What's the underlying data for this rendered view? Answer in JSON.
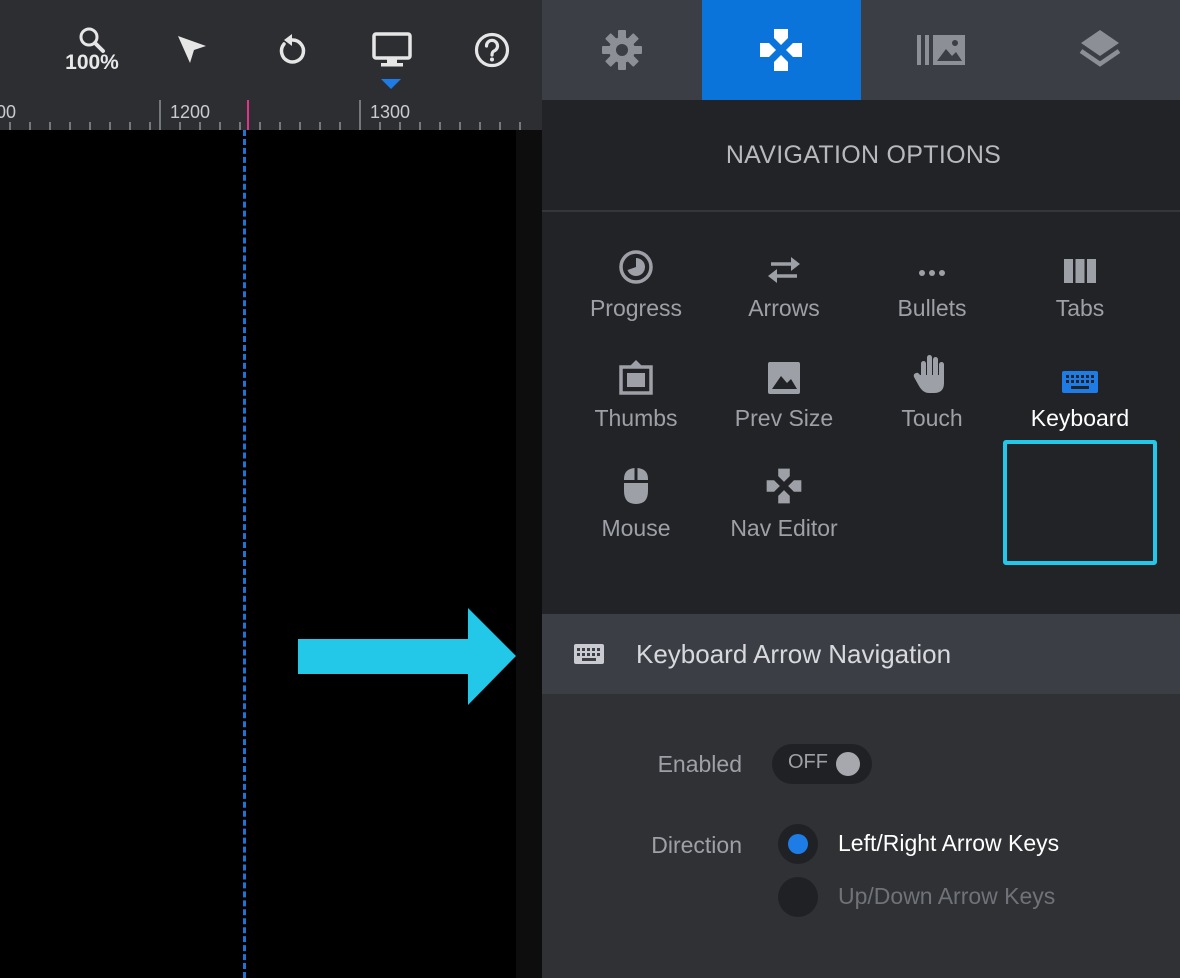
{
  "toolbar": {
    "zoom": "100%",
    "tools": [
      "zoom-icon",
      "select-pointer-icon",
      "undo-icon",
      "desktop-monitor-icon",
      "help-icon"
    ]
  },
  "ruler": {
    "labels": [
      "00",
      "1200",
      "1300"
    ]
  },
  "right_tabs": [
    {
      "name": "settings-gear-icon",
      "active": false
    },
    {
      "name": "navigation-gamepad-icon",
      "active": true
    },
    {
      "name": "slides-gallery-icon",
      "active": false
    },
    {
      "name": "layers-icon",
      "active": false
    }
  ],
  "panel": {
    "title": "NAVIGATION OPTIONS",
    "nav_items": [
      {
        "label": "Progress",
        "icon": "progress-icon"
      },
      {
        "label": "Arrows",
        "icon": "arrows-icon"
      },
      {
        "label": "Bullets",
        "icon": "bullets-icon"
      },
      {
        "label": "Tabs",
        "icon": "tabs-icon"
      },
      {
        "label": "Thumbs",
        "icon": "thumbs-icon"
      },
      {
        "label": "Prev Size",
        "icon": "image-icon"
      },
      {
        "label": "Touch",
        "icon": "hand-icon"
      },
      {
        "label": "Keyboard",
        "icon": "keyboard-icon",
        "selected": true
      },
      {
        "label": "Mouse",
        "icon": "mouse-icon"
      },
      {
        "label": "Nav Editor",
        "icon": "gamepad-icon"
      }
    ],
    "section_title": "Keyboard Arrow Navigation",
    "enabled_label": "Enabled",
    "toggle_state": "OFF",
    "direction_label": "Direction",
    "direction_options": [
      {
        "label": "Left/Right Arrow Keys",
        "checked": true
      },
      {
        "label": "Up/Down Arrow Keys",
        "checked": false
      }
    ]
  },
  "colors": {
    "accent": "#0a74da",
    "highlight_frame": "#23c7e8",
    "callout_arrow": "#23c7e8",
    "guide_line": "#1e74d2",
    "marker": "#e0348a"
  }
}
